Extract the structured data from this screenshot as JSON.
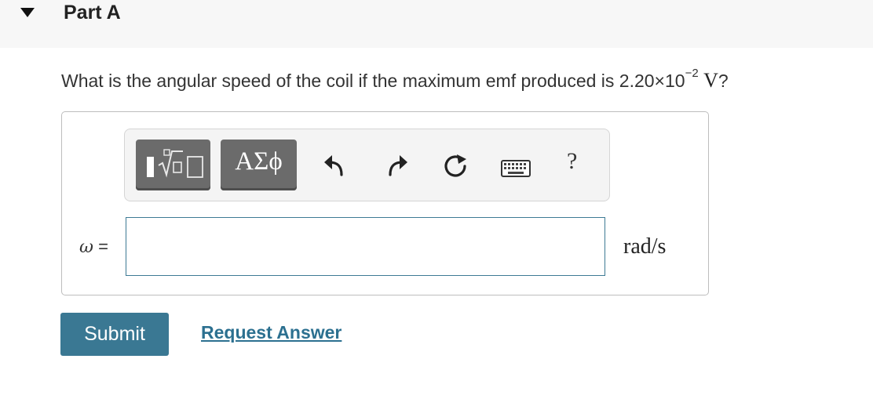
{
  "part": {
    "title": "Part A",
    "toggle_icon": "caret-down-icon"
  },
  "question": {
    "text": "What is the angular speed of the coil if the maximum emf produced is ",
    "value_mantissa": "2.20×10",
    "value_exponent": "−2",
    "unit": "V",
    "end": "?"
  },
  "toolbar": {
    "templates_icon": "templates-fraction-root-icon",
    "greek_label": "ΑΣϕ",
    "undo_icon": "undo-icon",
    "redo_icon": "redo-icon",
    "reset_icon": "reset-icon",
    "keyboard_icon": "keyboard-icon",
    "help_label": "?"
  },
  "answer": {
    "variable": "ω",
    "equals": "=",
    "value": "",
    "unit": "rad/s"
  },
  "actions": {
    "submit_label": "Submit",
    "request_label": "Request Answer"
  },
  "colors": {
    "header_bg": "#f7f7f7",
    "toolbar_button": "#6b6b6b",
    "input_border": "#3d7a94",
    "submit_bg": "#3a7893",
    "link": "#2c7090"
  }
}
